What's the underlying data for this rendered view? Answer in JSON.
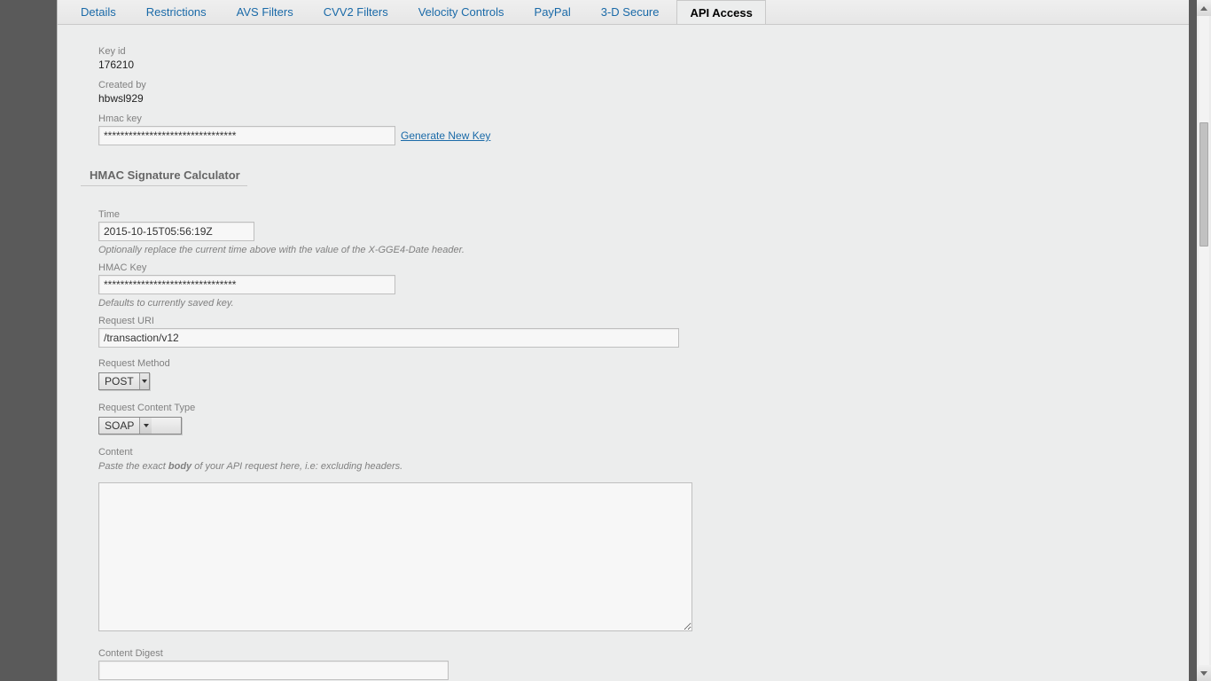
{
  "tabs": [
    {
      "label": "Details"
    },
    {
      "label": "Restrictions"
    },
    {
      "label": "AVS Filters"
    },
    {
      "label": "CVV2 Filters"
    },
    {
      "label": "Velocity Controls"
    },
    {
      "label": "PayPal"
    },
    {
      "label": "3-D Secure"
    },
    {
      "label": "API Access"
    }
  ],
  "active_tab": "API Access",
  "api": {
    "key_id_label": "Key id",
    "key_id_value": "176210",
    "created_by_label": "Created by",
    "created_by_value": "hbwsl929",
    "hmac_key_label": "Hmac key",
    "hmac_key_value": "********************************",
    "generate_link": "Generate New Key"
  },
  "calc": {
    "heading": "HMAC Signature Calculator",
    "time_label": "Time",
    "time_value": "2015-10-15T05:56:19Z",
    "time_help": "Optionally replace the current time above with the value of the X-GGE4-Date header.",
    "hmac_key_label": "HMAC Key",
    "hmac_key_value": "********************************",
    "hmac_key_help": "Defaults to currently saved key.",
    "uri_label": "Request URI",
    "uri_value": "/transaction/v12",
    "method_label": "Request Method",
    "method_value": "POST",
    "ctype_label": "Request Content Type",
    "ctype_value": "SOAP",
    "content_label": "Content",
    "content_help_pre": "Paste the exact ",
    "content_help_bold": "body",
    "content_help_post": " of your API request here, i.e: excluding headers.",
    "content_value": "",
    "digest_label": "Content Digest",
    "digest_value": ""
  }
}
